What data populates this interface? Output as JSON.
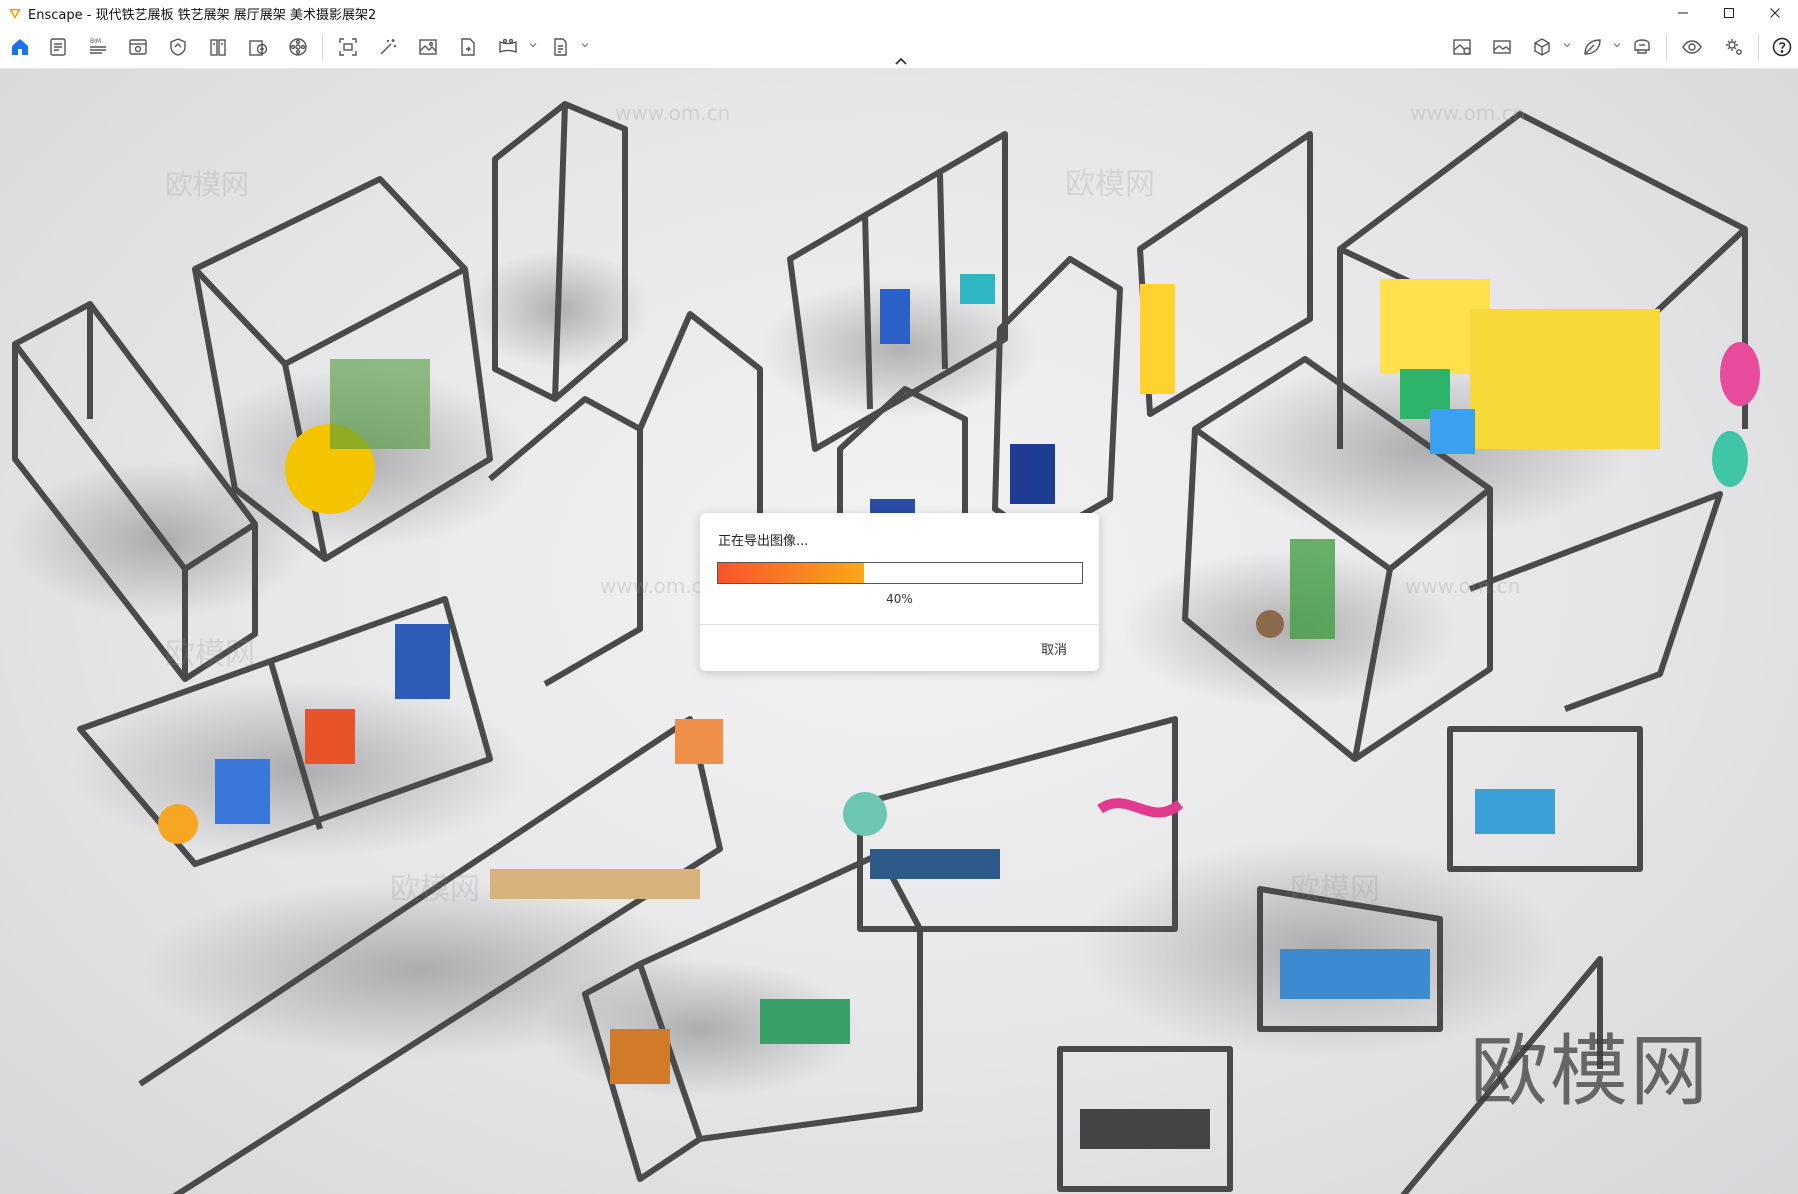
{
  "window": {
    "title": "Enscape - 现代铁艺展板 铁艺展架 展厅展架 美术摄影展架2",
    "controls": [
      "minimize-icon",
      "maximize-icon",
      "close-icon"
    ]
  },
  "toolbar": {
    "left_icons": [
      "home-icon",
      "document-icon",
      "bim-icon",
      "eye-view-icon",
      "shield-icon",
      "book-icon",
      "upload-asset-icon",
      "reel-icon",
      "screenshot-icon",
      "magic-wand-icon",
      "image-icon",
      "file-export-icon",
      "panorama-icon",
      "batch-render-icon"
    ],
    "bim_label": "BIM",
    "right_icons": [
      "capture-icon",
      "gallery-icon",
      "cube-icon",
      "leaf-icon",
      "vr-headset-icon",
      "eye-icon",
      "settings-icon",
      "help-icon"
    ],
    "accent_color": "#1a73e8"
  },
  "watermarks": {
    "brand": "欧模网",
    "url": "www.om.cn"
  },
  "export_dialog": {
    "title": "正在导出图像...",
    "progress_percent": 40,
    "progress_label": "40%",
    "cancel_label": "取消",
    "progress_colors": [
      "#f6552a",
      "#fda61a"
    ]
  }
}
